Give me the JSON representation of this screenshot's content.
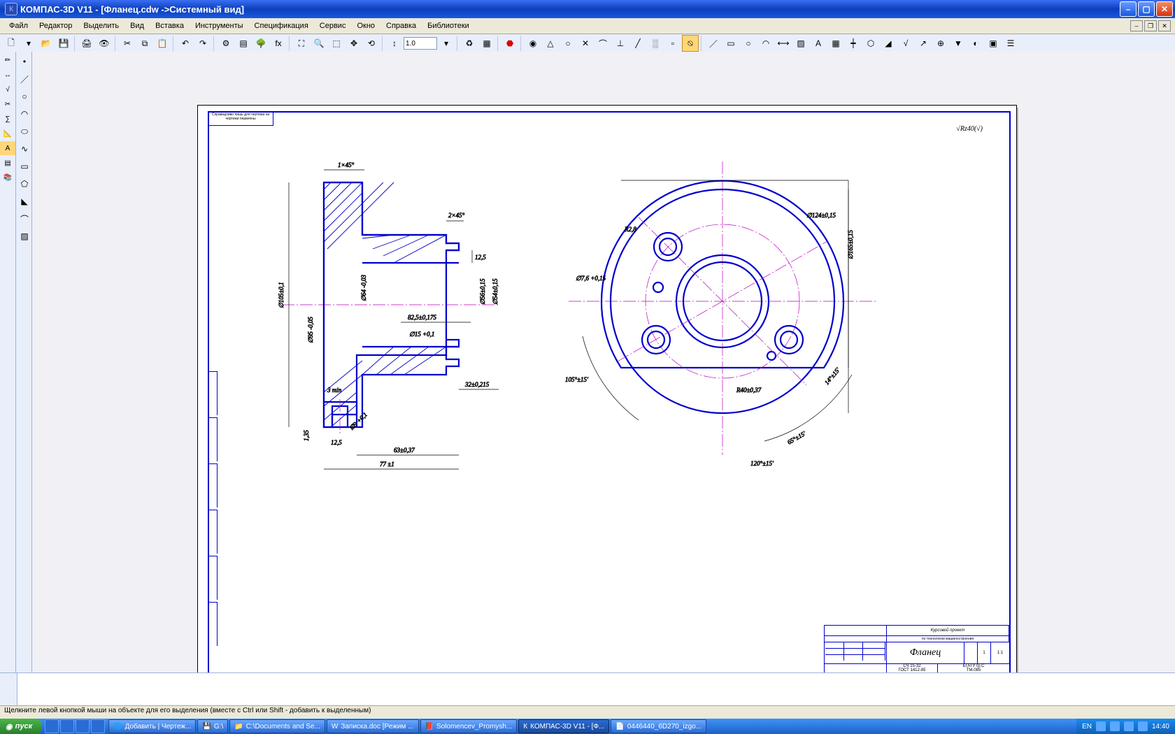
{
  "title": "КОМПАС-3D V11 - [Фланец.cdw ->Системный вид]",
  "menus": [
    "Файл",
    "Редактор",
    "Выделить",
    "Вид",
    "Вставка",
    "Инструменты",
    "Спецификация",
    "Сервис",
    "Окно",
    "Справка",
    "Библиотеки"
  ],
  "zoom": "1.0",
  "statusbar": "Щелкните левой кнопкой мыши на объекте для его выделения (вместе с Ctrl или Shift - добавить к выделенным)",
  "roughness_mark": "√Rz40(√)",
  "stamp_tl": "Справедливо лишь для чертежа на чертежи первичны",
  "part_name": "Фланец",
  "titleblock": {
    "project": "Курсовой проект",
    "project_sub": "по технологии машиностроения",
    "material": "СЧ 15-32",
    "gost": "ГОСТ 1412-85",
    "scale": "1:1",
    "mass": "",
    "group": "БГАТУ гр.С",
    "code": "ТМ-085"
  },
  "dims_left": {
    "d1": "1×45°",
    "d2": "2×45°",
    "d3": "12,5",
    "d4": "82,5±0,175",
    "d5": "∅105±0,1",
    "d6": "∅64 -0,03",
    "d7": "∅95 -0,05",
    "d8": "∅56±0,15",
    "d9": "∅54±0,15",
    "d10": "32±0,215",
    "d11": "63±0,37",
    "d12": "77 ±1",
    "d13": "1,35",
    "d14": "3 min",
    "d15": "12,5",
    "d16": "∅9 +0,1",
    "d17": "∅15 +0,1"
  },
  "dims_right": {
    "a1": "∅7,6 +0,15",
    "a2": "R2,8",
    "a3": "∅165±0,15",
    "a4": "∅124±0,15",
    "a5": "R40±0,37",
    "a6": "105°±15'",
    "a7": "65°±15'",
    "a8": "120°±15'",
    "a9": "14°±15'"
  },
  "taskbar": {
    "start": "пуск",
    "items": [
      "Добавить | Чертеж...",
      "G:\\",
      "C:\\Documents and Se...",
      "Записка.doc [Режим ...",
      "Solomencev_Promysh...",
      "КОМПАС-3D V11 - [Ф...",
      "0446440_6D270_izgo..."
    ],
    "lang": "EN",
    "time": "14:40"
  }
}
